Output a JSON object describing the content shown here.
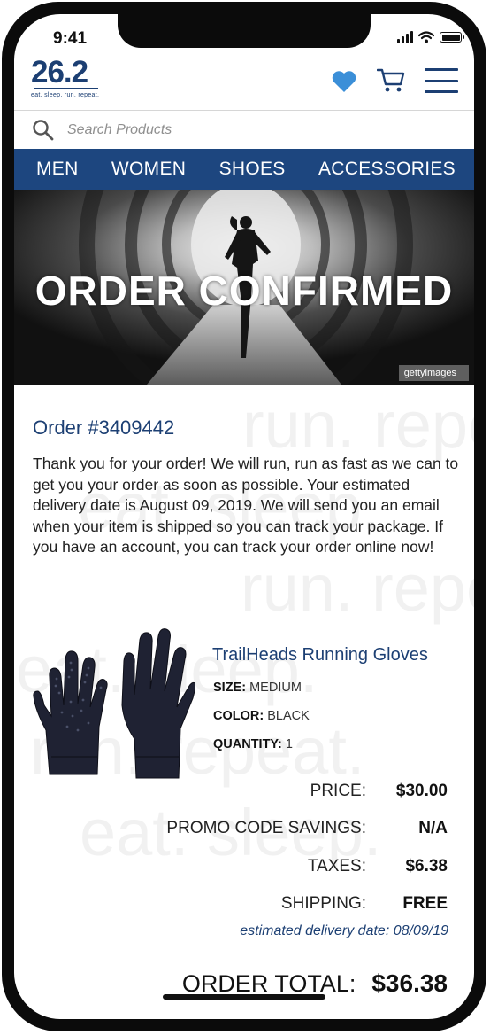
{
  "status_bar": {
    "time": "9:41"
  },
  "brand": {
    "logo_text": "26.2",
    "tagline": "eat. sleep. run. repeat."
  },
  "header_icons": [
    "heart-icon",
    "cart-icon",
    "menu-icon"
  ],
  "search": {
    "placeholder": "Search Products"
  },
  "nav": {
    "items": [
      "MEN",
      "WOMEN",
      "SHOES",
      "ACCESSORIES"
    ]
  },
  "hero": {
    "title": "ORDER CONFIRMED",
    "credit": "gettyimages"
  },
  "order": {
    "number": "Order #3409442",
    "message": "Thank you for your order! We will run, run as fast as we can to get you your order as soon as possible. Your estimated delivery date is August 09, 2019. We will send you an email when your item is shipped so you can track your package. If you have an account, you can track your order online now!"
  },
  "product": {
    "name": "TrailHeads Running Gloves",
    "size_label": "SIZE:",
    "size": "MEDIUM",
    "color_label": "COLOR:",
    "color": "BLACK",
    "quantity_label": "QUANTITY:",
    "quantity": "1"
  },
  "summary": {
    "price_label": "PRICE:",
    "price": "$30.00",
    "promo_label": "PROMO CODE SAVINGS:",
    "promo": "N/A",
    "taxes_label": "TAXES:",
    "taxes": "$6.38",
    "shipping_label": "SHIPPING:",
    "shipping": "FREE",
    "eta_label": "estimated delivery date:",
    "eta": "08/09/19",
    "total_label": "ORDER TOTAL:",
    "total": "$36.38"
  },
  "watermark": {
    "lines": [
      "run. repeat.",
      "eat. sleep.",
      "run. repeat.",
      "eat. sleep.",
      "run. repeat.",
      "eat. sleep."
    ]
  },
  "colors": {
    "brand_blue": "#1c3f73",
    "nav_blue": "#1d467f",
    "heart_blue": "#3b8fd8"
  }
}
